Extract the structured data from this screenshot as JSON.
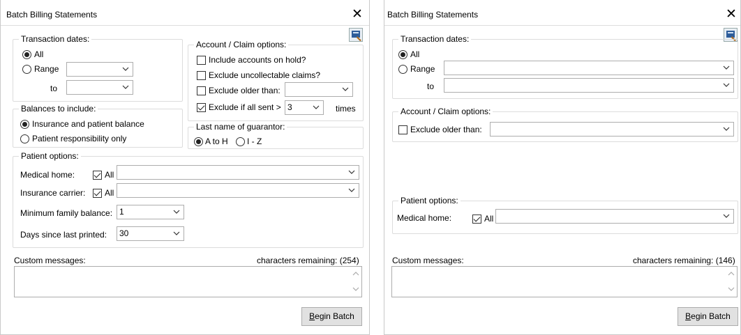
{
  "left": {
    "title": "Batch Billing Statements",
    "close_glyph": "✕",
    "transaction": {
      "legend": "Transaction dates:",
      "all_label": "All",
      "all_selected": true,
      "range_label": "Range",
      "to_label": "to"
    },
    "balances": {
      "legend": "Balances to include:",
      "opt1": "Insurance and patient balance",
      "opt2": "Patient responsibility only",
      "selected": "opt1"
    },
    "account": {
      "legend": "Account / Claim options:",
      "hold_label": "Include accounts on hold?",
      "hold_checked": false,
      "uncollect_label": "Exclude uncollectable claims?",
      "uncollect_checked": false,
      "older_label": "Exclude older than:",
      "older_checked": false,
      "sent_label": "Exclude if all sent >",
      "sent_checked": true,
      "sent_value": "3",
      "times_label": "times"
    },
    "guarantor": {
      "legend": "Last name of guarantor:",
      "opt_a": "A to H",
      "opt_b": "I - Z",
      "selected": "A to H"
    },
    "patient": {
      "legend": "Patient options:",
      "medical_label": "Medical home:",
      "medical_all_label": "All",
      "medical_all_checked": true,
      "insurance_label": "Insurance carrier:",
      "insurance_all_label": "All",
      "insurance_all_checked": true,
      "min_label": "Minimum family balance:",
      "min_value": "1",
      "days_label": "Days since last printed:",
      "days_value": "30"
    },
    "custom": {
      "label": "Custom messages:",
      "remaining": "characters remaining: (254)"
    },
    "begin_prefix": "B",
    "begin_rest": "egin Batch"
  },
  "right": {
    "title": "Batch Billing Statements",
    "close_glyph": "✕",
    "transaction": {
      "legend": "Transaction dates:",
      "all_label": "All",
      "all_selected": true,
      "range_label": "Range",
      "to_label": "to"
    },
    "account": {
      "legend": "Account / Claim options:",
      "older_label": "Exclude older than:",
      "older_checked": false
    },
    "patient": {
      "legend": "Patient options:",
      "medical_label": "Medical home:",
      "medical_all_label": "All",
      "medical_all_checked": true
    },
    "custom": {
      "label": "Custom messages:",
      "remaining": "characters remaining: (146)"
    },
    "begin_prefix": "B",
    "begin_rest": "egin Batch"
  },
  "colors": {
    "border": "#dcdcdc",
    "button_bg": "#e1e1e1",
    "icon_accent": "#2e5d9a"
  },
  "icons": {
    "close": "close-icon",
    "options": "printer-settings-icon",
    "dropdown": "chevron-down-icon"
  }
}
